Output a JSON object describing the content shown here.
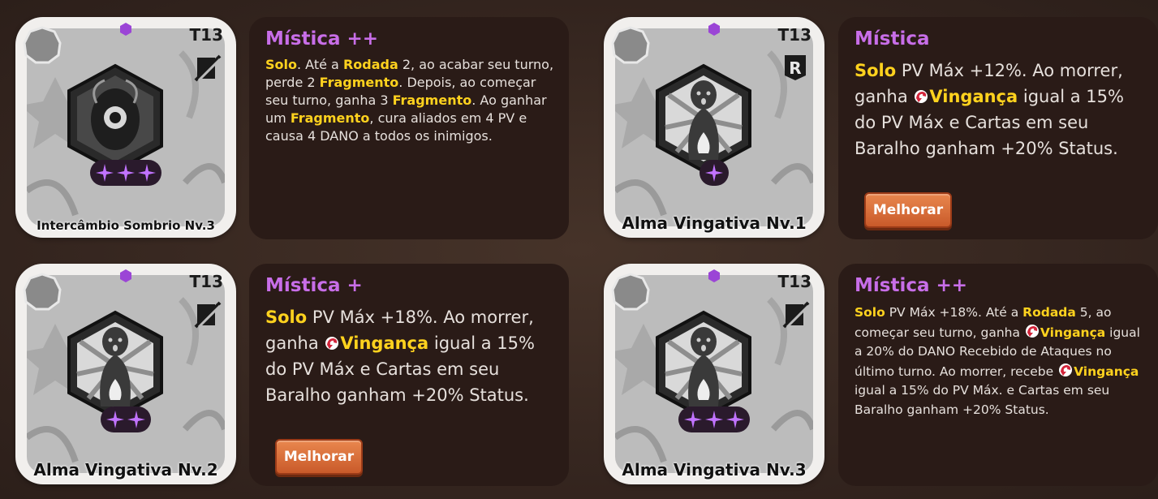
{
  "colors": {
    "title_purple": "#c86ee8",
    "highlight_yellow": "#ffd21e",
    "panel_bg": "#2a1b17",
    "button_orange": "#d86c38"
  },
  "cards": [
    {
      "tier": "T13",
      "type_icon": "slashed-card-icon",
      "emblem": "dark-eye-swirl",
      "stars": 3,
      "name": "Intercâmbio Sombrio Nv.3",
      "rarity": "Mística ++",
      "desc": [
        {
          "t": "Solo",
          "hl": true
        },
        {
          "t": ". Até a "
        },
        {
          "t": "Rodada",
          "hl": true
        },
        {
          "t": " 2, ao acabar seu turno, perde 2 "
        },
        {
          "t": "Fragmento",
          "hl": true
        },
        {
          "t": ". Depois, ao começar seu turno, ganha 3 "
        },
        {
          "t": "Fragmento",
          "hl": true
        },
        {
          "t": ". Ao ganhar um "
        },
        {
          "t": "Fragmento",
          "hl": true
        },
        {
          "t": ", cura aliados em 4 PV e causa 4 DANO a todos os inimigos."
        }
      ]
    },
    {
      "tier": "T13",
      "type_icon": "relic-r-icon",
      "emblem": "vengeful-soul",
      "stars": 1,
      "name": "Alma Vingativa Nv.1",
      "rarity": "Mística",
      "desc": [
        {
          "t": "Solo",
          "hl": true
        },
        {
          "t": " PV Máx +12%. Ao morrer, ganha "
        },
        {
          "t": "",
          "icon": "vengeance-icon"
        },
        {
          "t": "Vingança",
          "hl": true
        },
        {
          "t": " igual a 15% do PV Máx e Cartas em seu Baralho ganham +20% Status."
        }
      ],
      "button": "Melhorar"
    },
    {
      "tier": "T13",
      "type_icon": "slashed-card-icon",
      "emblem": "vengeful-soul",
      "stars": 2,
      "name": "Alma Vingativa Nv.2",
      "rarity": "Mística +",
      "desc": [
        {
          "t": "Solo",
          "hl": true
        },
        {
          "t": " PV Máx +18%. Ao morrer, ganha "
        },
        {
          "t": "",
          "icon": "vengeance-icon"
        },
        {
          "t": "Vingança",
          "hl": true
        },
        {
          "t": " igual a 15% do PV Máx e Cartas em seu Baralho ganham +20% Status."
        }
      ],
      "button": "Melhorar"
    },
    {
      "tier": "T13",
      "type_icon": "slashed-card-icon",
      "emblem": "vengeful-soul",
      "stars": 3,
      "name": "Alma Vingativa Nv.3",
      "rarity": "Mística ++",
      "desc": [
        {
          "t": "Solo",
          "hl": true
        },
        {
          "t": " PV Máx +18%. Até a "
        },
        {
          "t": "Rodada",
          "hl": true
        },
        {
          "t": " 5, ao começar seu turno, ganha "
        },
        {
          "t": "",
          "icon": "vengeance-icon"
        },
        {
          "t": "Vingança",
          "hl": true
        },
        {
          "t": " igual a 20% do DANO Recebido de Ataques no último turno. Ao morrer, recebe "
        },
        {
          "t": "",
          "icon": "vengeance-icon"
        },
        {
          "t": "Vingança",
          "hl": true
        },
        {
          "t": " igual a 15% do PV Máx. e Cartas em seu Baralho ganham +20% Status."
        }
      ]
    }
  ]
}
